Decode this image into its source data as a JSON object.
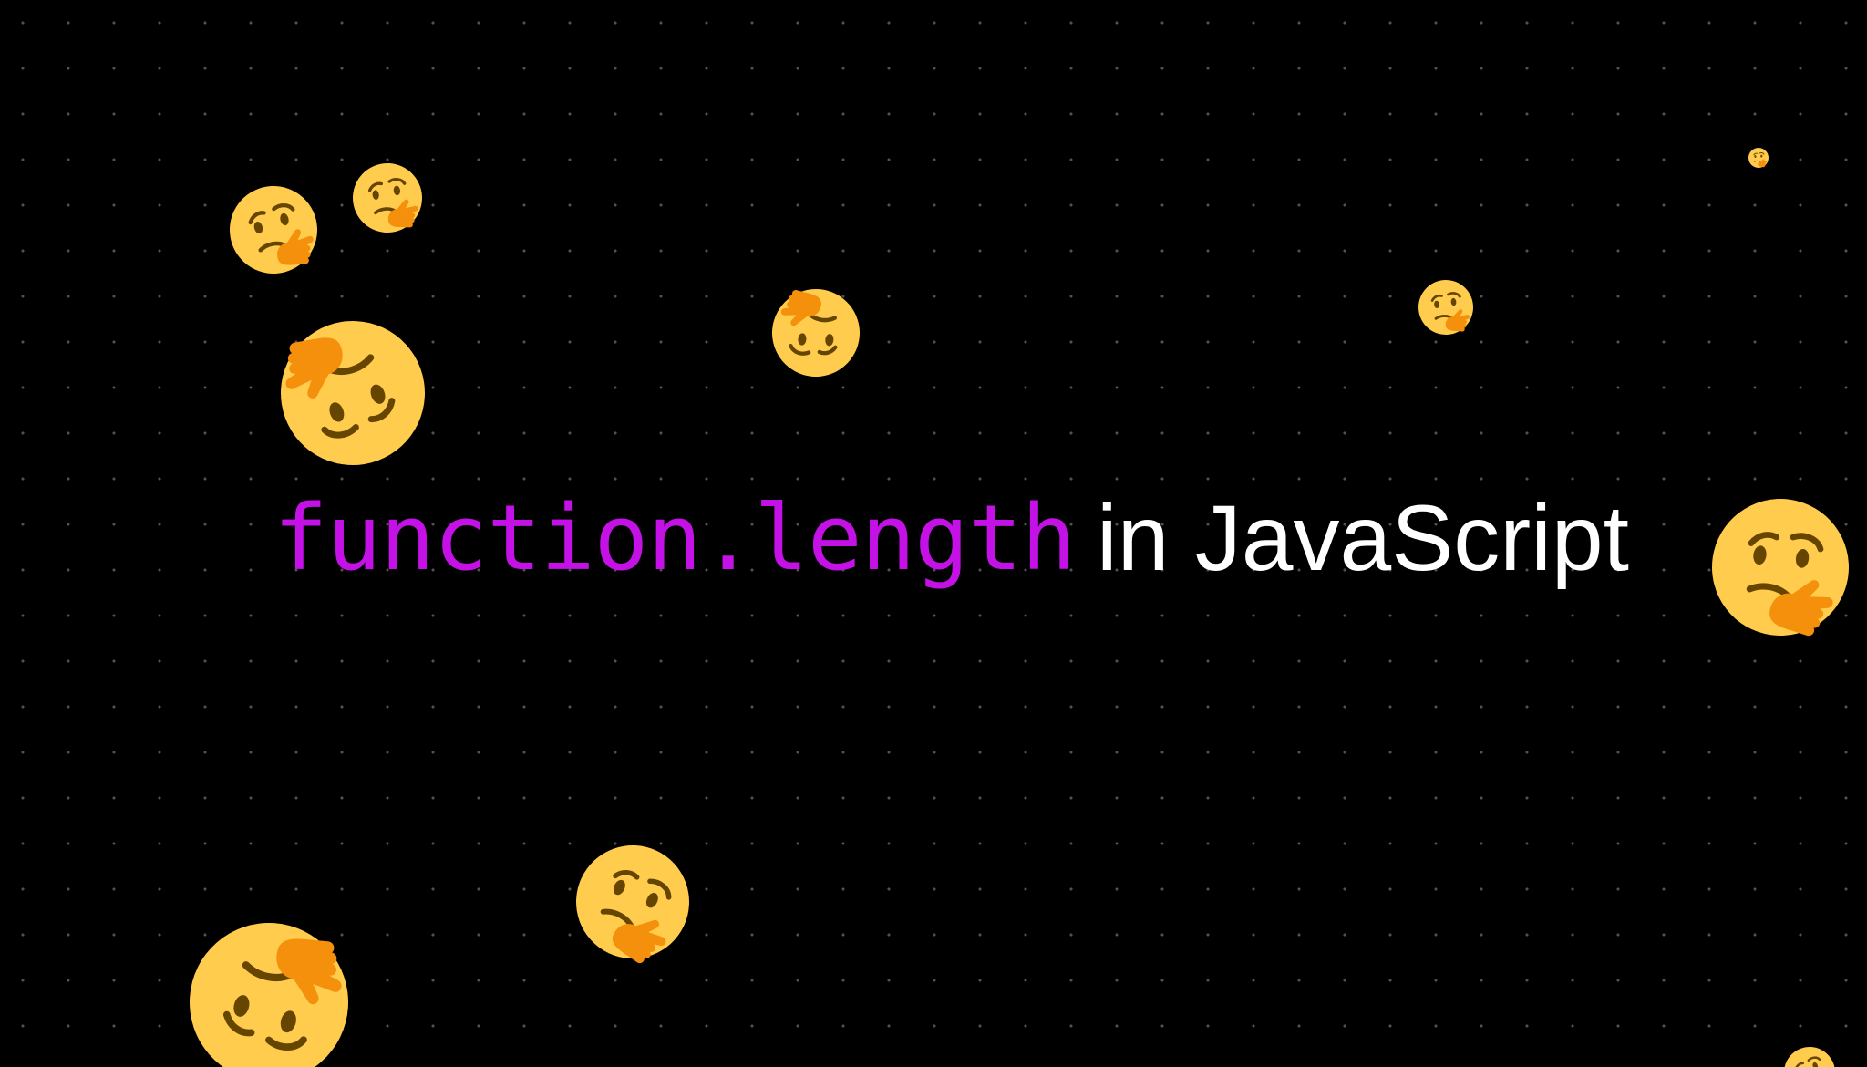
{
  "headline": {
    "code": "function.length",
    "text": "in JavaScript"
  },
  "colors": {
    "background": "#000000",
    "dot_grid": "#ffffff",
    "code_accent": "#c311e6",
    "text": "#ffffff",
    "emoji_face": "#ffcc4d",
    "emoji_hand": "#f4900c",
    "emoji_features": "#664500"
  },
  "decorations": {
    "icon": "thinking-face-emoji",
    "count": 11
  }
}
